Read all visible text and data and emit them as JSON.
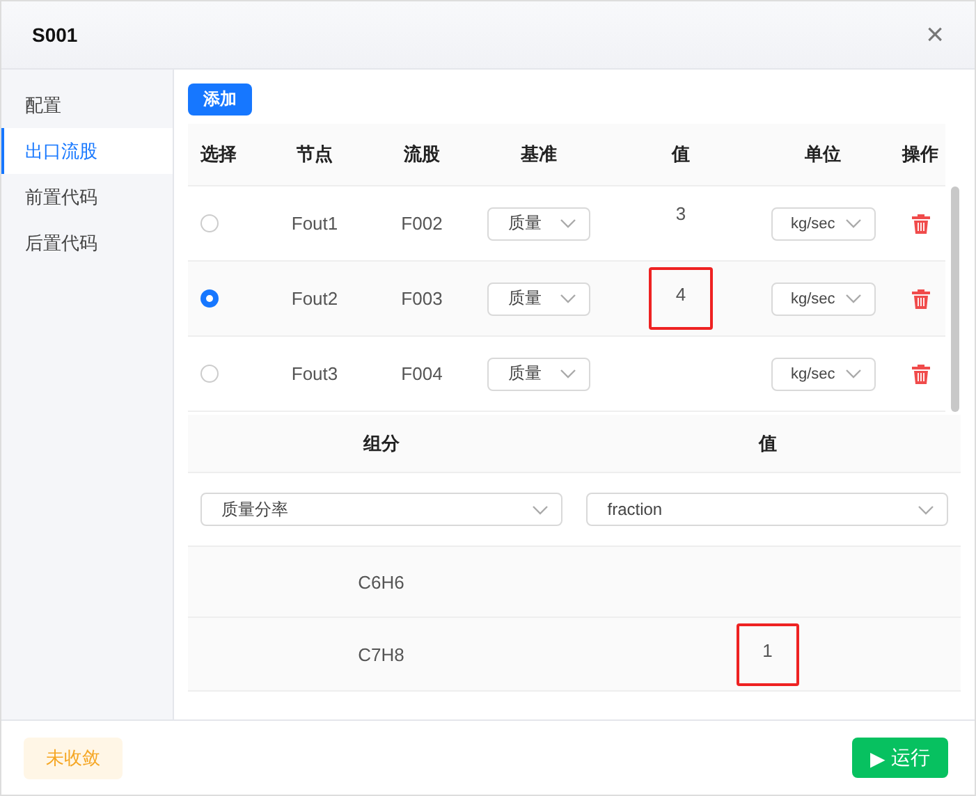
{
  "window": {
    "title": "S001",
    "close": "×"
  },
  "sidebar": {
    "items": [
      {
        "label": "配置",
        "selected": false
      },
      {
        "label": "出口流股",
        "selected": true
      },
      {
        "label": "前置代码",
        "selected": false
      },
      {
        "label": "后置代码",
        "selected": false
      }
    ]
  },
  "toolbar": {
    "add_button": "添加"
  },
  "table": {
    "columns": [
      "选择",
      "节点",
      "流股",
      "基准",
      "值",
      "单位",
      "操作"
    ],
    "rows": [
      {
        "selected": false,
        "node": "Fout1",
        "stream": "F002",
        "basis": "质量",
        "value": "3",
        "highlighted": false,
        "unit": "kg/sec"
      },
      {
        "selected": true,
        "node": "Fout2",
        "stream": "F003",
        "basis": "质量",
        "value": "4",
        "highlighted": true,
        "unit": "kg/sec"
      },
      {
        "selected": false,
        "node": "Fout3",
        "stream": "F004",
        "basis": "质量",
        "value": "",
        "highlighted": false,
        "unit": "kg/sec"
      }
    ]
  },
  "composition": {
    "columns": [
      "组分",
      "值"
    ],
    "component_basis": "质量分率",
    "value_unit": "fraction",
    "rows": [
      {
        "component": "C6H6",
        "value": "",
        "highlighted": false
      },
      {
        "component": "C7H8",
        "value": "1",
        "highlighted": true
      }
    ]
  },
  "footer": {
    "status": "未收敛",
    "run_button": {
      "icon": "▶",
      "label": "运行"
    }
  }
}
